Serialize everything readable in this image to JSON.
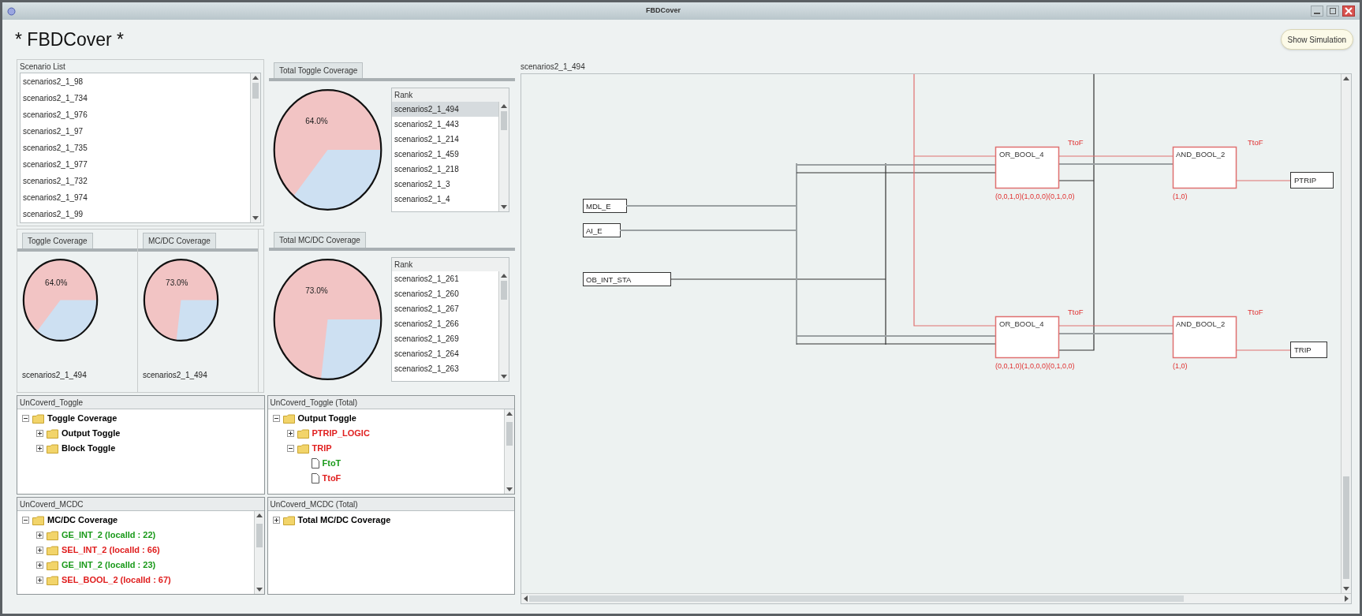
{
  "window": {
    "title": "FBDCover"
  },
  "header": {
    "title": "* FBDCover *",
    "button": "Show Simulation"
  },
  "scenario_list": {
    "title": "Scenario List",
    "items": [
      "scenarios2_1_98",
      "scenarios2_1_734",
      "scenarios2_1_976",
      "scenarios2_1_97",
      "scenarios2_1_735",
      "scenarios2_1_977",
      "scenarios2_1_732",
      "scenarios2_1_974",
      "scenarios2_1_99"
    ]
  },
  "total_toggle": {
    "tab": "Total Toggle Coverage",
    "percent": "64.0%",
    "rank": {
      "title": "Rank",
      "items": [
        {
          "label": "scenarios2_1_494",
          "selected": true
        },
        {
          "label": "scenarios2_1_443",
          "selected": false
        },
        {
          "label": "scenarios2_1_214",
          "selected": false
        },
        {
          "label": "scenarios2_1_459",
          "selected": false
        },
        {
          "label": "scenarios2_1_218",
          "selected": false
        },
        {
          "label": "scenarios2_1_3",
          "selected": false
        },
        {
          "label": "scenarios2_1_4",
          "selected": false
        }
      ]
    }
  },
  "toggle_coverage": {
    "tab": "Toggle Coverage",
    "percent": "64.0%",
    "scenario": "scenarios2_1_494"
  },
  "mcdc_coverage": {
    "tab": "MC/DC Coverage",
    "percent": "73.0%",
    "scenario": "scenarios2_1_494"
  },
  "total_mcdc": {
    "tab": "Total MC/DC Coverage",
    "percent": "73.0%",
    "rank": {
      "title": "Rank",
      "items": [
        {
          "label": "scenarios2_1_261",
          "selected": false
        },
        {
          "label": "scenarios2_1_260",
          "selected": false
        },
        {
          "label": "scenarios2_1_267",
          "selected": false
        },
        {
          "label": "scenarios2_1_266",
          "selected": false
        },
        {
          "label": "scenarios2_1_269",
          "selected": false
        },
        {
          "label": "scenarios2_1_264",
          "selected": false
        },
        {
          "label": "scenarios2_1_263",
          "selected": false
        }
      ]
    }
  },
  "uncovered_toggle": {
    "title": "UnCoverd_Toggle",
    "tree": [
      {
        "label": "Toggle Coverage",
        "kind": "folder",
        "color": "#000000",
        "expanded": true,
        "children": [
          {
            "label": "Output Toggle",
            "kind": "folder",
            "color": "#000000",
            "expanded": false
          },
          {
            "label": "Block Toggle",
            "kind": "folder",
            "color": "#000000",
            "expanded": false
          }
        ]
      }
    ]
  },
  "uncovered_toggle_total": {
    "title": "UnCoverd_Toggle (Total)",
    "tree": [
      {
        "label": "Output Toggle",
        "kind": "folder",
        "color": "#000000",
        "expanded": true,
        "children": [
          {
            "label": "PTRIP_LOGIC",
            "kind": "folder",
            "color": "#e02020",
            "expanded": false
          },
          {
            "label": "TRIP",
            "kind": "folder",
            "color": "#e02020",
            "expanded": true,
            "children": [
              {
                "label": "FtoT",
                "kind": "file",
                "color": "#1a9a1a"
              },
              {
                "label": "TtoF",
                "kind": "file",
                "color": "#e02020"
              }
            ]
          }
        ]
      }
    ]
  },
  "uncovered_mcdc": {
    "title": "UnCoverd_MCDC",
    "tree": [
      {
        "label": "MC/DC Coverage",
        "kind": "folder",
        "color": "#000000",
        "expanded": true,
        "children": [
          {
            "label": "GE_INT_2 (localId : 22)",
            "kind": "folder",
            "color": "#1a9a1a",
            "expanded": false
          },
          {
            "label": "SEL_INT_2 (localId : 66)",
            "kind": "folder",
            "color": "#e02020",
            "expanded": false
          },
          {
            "label": "GE_INT_2 (localId : 23)",
            "kind": "folder",
            "color": "#1a9a1a",
            "expanded": false
          },
          {
            "label": "SEL_BOOL_2 (localId : 67)",
            "kind": "folder",
            "color": "#e02020",
            "expanded": false
          }
        ]
      }
    ]
  },
  "uncovered_mcdc_total": {
    "title": "UnCoverd_MCDC (Total)",
    "tree": [
      {
        "label": "Total MC/DC Coverage",
        "kind": "folder",
        "color": "#000000",
        "expanded": false
      }
    ]
  },
  "diagram": {
    "title": "scenarios2_1_494",
    "inputs": [
      "MDL_E",
      "AI_E",
      "OB_INT_STA"
    ],
    "rungs": [
      {
        "or_block": {
          "name": "OR_BOOL_4",
          "transition": "TtoF",
          "vector": "(0,0,1,0)(1,0,0,0)(0,1,0,0)"
        },
        "and_block": {
          "name": "AND_BOOL_2",
          "transition": "TtoF",
          "vector": "(1,0)"
        },
        "output": "PTRIP"
      },
      {
        "or_block": {
          "name": "OR_BOOL_4",
          "transition": "TtoF",
          "vector": "(0,0,1,0)(1,0,0,0)(0,1,0,0)"
        },
        "and_block": {
          "name": "AND_BOOL_2",
          "transition": "TtoF",
          "vector": "(1,0)"
        },
        "output": "TRIP"
      }
    ]
  }
}
